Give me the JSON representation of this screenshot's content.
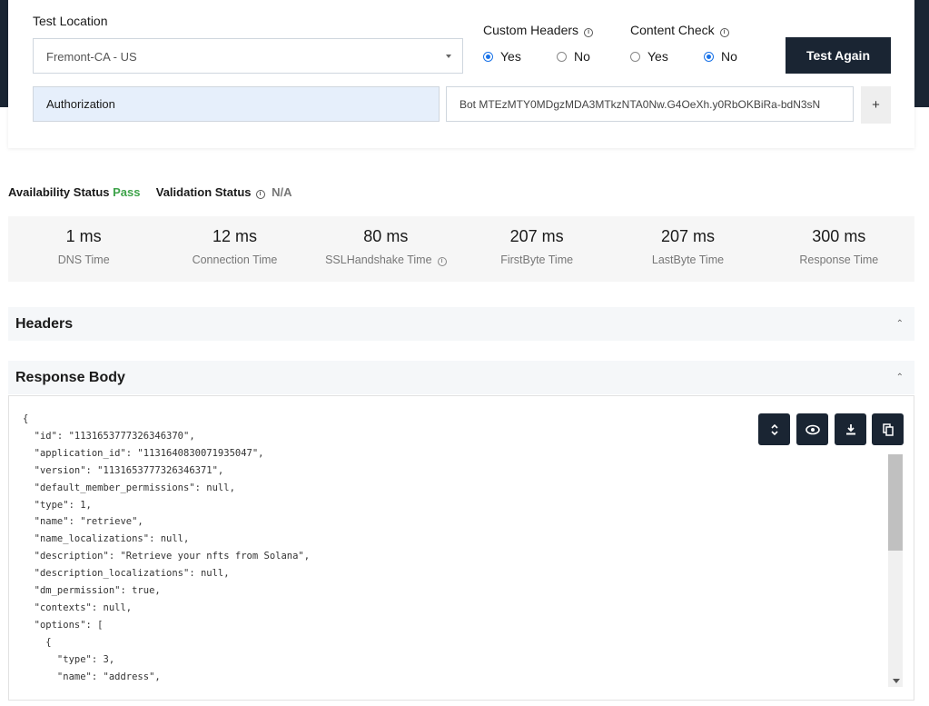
{
  "config": {
    "test_location_label": "Test Location",
    "test_location_value": "Fremont-CA - US",
    "custom_headers": {
      "label": "Custom Headers",
      "options": [
        "Yes",
        "No"
      ],
      "selected": "Yes"
    },
    "content_check": {
      "label": "Content Check",
      "options": [
        "Yes",
        "No"
      ],
      "selected": "No"
    },
    "test_again_label": "Test Again",
    "header_key": "Authorization",
    "header_value": "Bot MTEzMTY0MDgzMDA3MTkzNTA0Nw.G4OeXh.y0RbOKBiRa-bdN3sN",
    "add_label": "+"
  },
  "status": {
    "availability_label": "Availability Status",
    "availability_value": "Pass",
    "validation_label": "Validation Status",
    "validation_value": "N/A",
    "colors": {
      "pass": "#3ea34a",
      "na": "#777777"
    }
  },
  "metrics": [
    {
      "value": "1 ms",
      "label": "DNS Time"
    },
    {
      "value": "12 ms",
      "label": "Connection Time"
    },
    {
      "value": "80 ms",
      "label": "SSLHandshake Time",
      "info": true
    },
    {
      "value": "207 ms",
      "label": "FirstByte Time"
    },
    {
      "value": "207 ms",
      "label": "LastByte Time"
    },
    {
      "value": "300 ms",
      "label": "Response Time"
    }
  ],
  "sections": {
    "headers_title": "Headers",
    "response_body_title": "Response Body"
  },
  "response_body": {
    "lines": [
      "{",
      "  \"id\": \"1131653777326346370\",",
      "  \"application_id\": \"1131640830071935047\",",
      "  \"version\": \"1131653777326346371\",",
      "  \"default_member_permissions\": null,",
      "  \"type\": 1,",
      "  \"name\": \"retrieve\",",
      "  \"name_localizations\": null,",
      "  \"description\": \"Retrieve your nfts from Solana\",",
      "  \"description_localizations\": null,",
      "  \"dm_permission\": true,",
      "  \"contexts\": null,",
      "  \"options\": [",
      "    {",
      "      \"type\": 3,",
      "      \"name\": \"address\","
    ],
    "toolbar_icons": [
      "expand-collapse-icon",
      "eye-icon",
      "download-icon",
      "copy-icon"
    ]
  },
  "colors": {
    "dark": "#1a2533",
    "accent": "#1a73e8"
  }
}
